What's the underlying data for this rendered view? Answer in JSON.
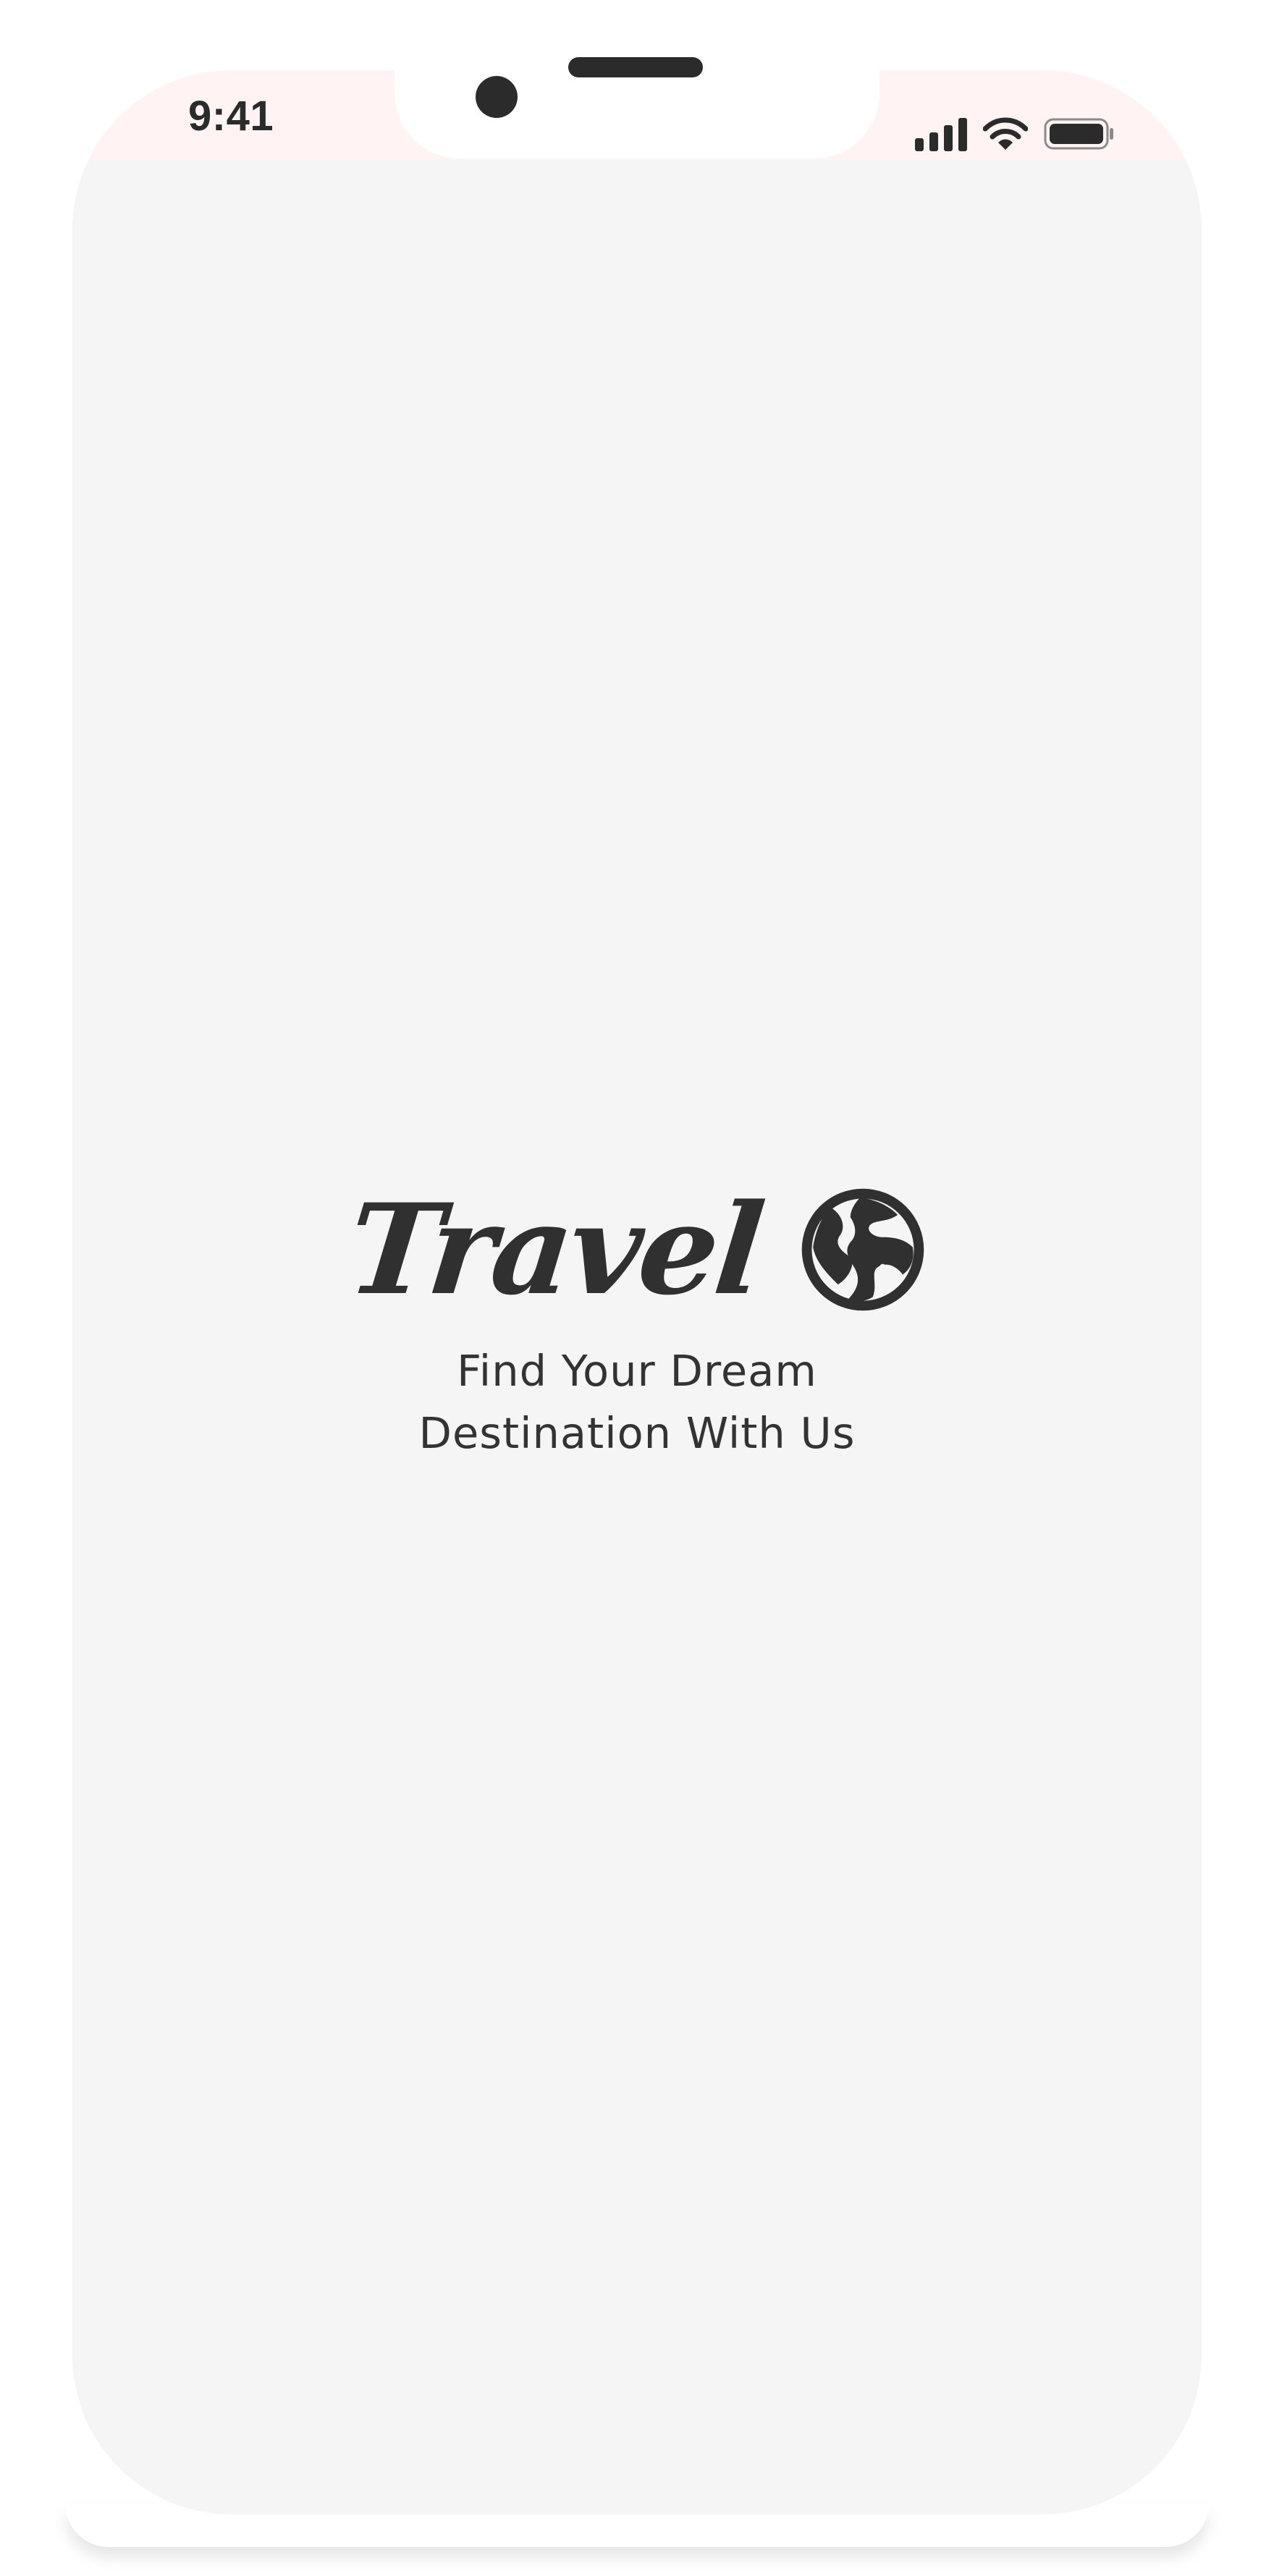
{
  "status_bar": {
    "time": "9:41",
    "icons": [
      "cellular-signal-icon",
      "wifi-icon",
      "battery-icon"
    ],
    "tint_color": "#fff3f3"
  },
  "splash": {
    "brand_name": "Travel",
    "brand_icon": "globe-icon",
    "tagline_line1": "Find Your Dream",
    "tagline_line2": "Destination With Us"
  },
  "colors": {
    "background": "#f5f5f5",
    "text": "#303030",
    "frame": "#ffffff"
  }
}
